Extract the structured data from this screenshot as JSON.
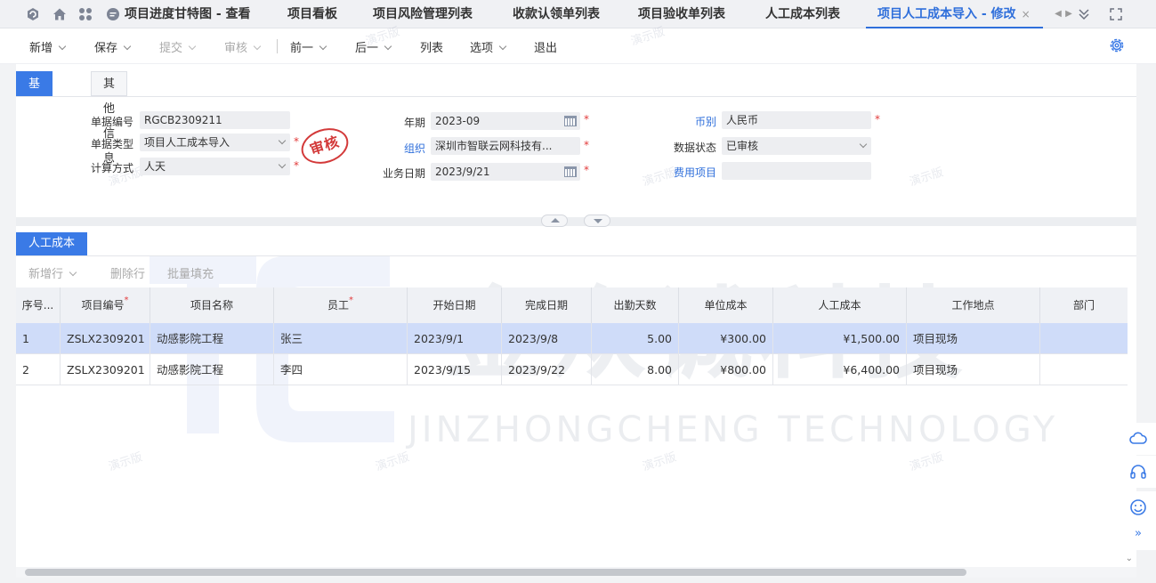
{
  "tabs": [
    {
      "label": "项目进度甘特图 - 查看"
    },
    {
      "label": "项目看板"
    },
    {
      "label": "项目风险管理列表"
    },
    {
      "label": "收款认领单列表"
    },
    {
      "label": "项目验收单列表"
    },
    {
      "label": "人工成本列表"
    },
    {
      "label": "项目人工成本导入 - 修改",
      "active": true
    }
  ],
  "tab_close": "×",
  "toolbar": {
    "new": "新增",
    "save": "保存",
    "submit": "提交",
    "audit": "审核",
    "prev": "前一",
    "next": "后一",
    "list": "列表",
    "options": "选项",
    "exit": "退出"
  },
  "subtabs": {
    "basic": "基本信息",
    "other": "其他信息"
  },
  "form": {
    "doc_no_label": "单据编号",
    "doc_no": "RGCB2309211",
    "doc_type_label": "单据类型",
    "doc_type": "项目人工成本导入",
    "calc_label": "计算方式",
    "calc": "人天",
    "period_label": "年期",
    "period": "2023-09",
    "org_label": "组织",
    "org": "深圳市智联云网科技有...",
    "biz_date_label": "业务日期",
    "biz_date": "2023/9/21",
    "currency_label": "币别",
    "currency": "人民币",
    "status_label": "数据状态",
    "status": "已审核",
    "expense_label": "费用项目",
    "expense": "",
    "required_mark": "*"
  },
  "stamp": "审核",
  "section": {
    "title": "人工成本",
    "add_row": "新增行",
    "delete_row": "删除行",
    "batch_fill": "批量填充"
  },
  "grid": {
    "headers": [
      "序号...",
      "项目编号",
      "项目名称",
      "员工",
      "开始日期",
      "完成日期",
      "出勤天数",
      "单位成本",
      "人工成本",
      "工作地点",
      "部门"
    ],
    "rows": [
      [
        "1",
        "ZSLX2309201",
        "动感影院工程",
        "张三",
        "2023/9/1",
        "2023/9/8",
        "5.00",
        "¥300.00",
        "¥1,500.00",
        "项目现场",
        ""
      ],
      [
        "2",
        "ZSLX2309201",
        "动感影院工程",
        "李四",
        "2023/9/15",
        "2023/9/22",
        "8.00",
        "¥800.00",
        "¥6,400.00",
        "项目现场",
        ""
      ]
    ]
  },
  "watermark": {
    "text": "演示版",
    "logo_letters": "JC",
    "company": "金众诚科技",
    "company_en": "JINZHONGCHENG TECHNOLOGY"
  },
  "colors": {
    "accent": "#3a7ae6",
    "required": "#e23b3b",
    "selected_row": "#cfdcf9"
  }
}
